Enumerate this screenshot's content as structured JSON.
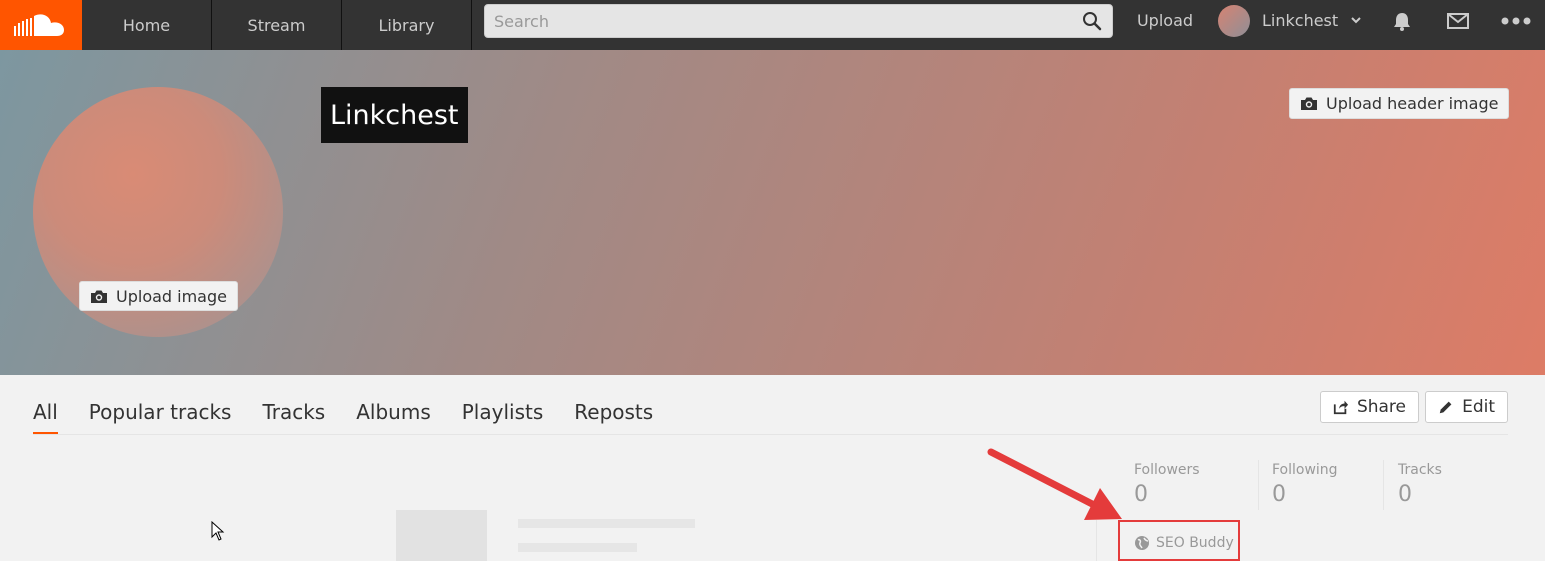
{
  "nav": {
    "home": "Home",
    "stream": "Stream",
    "library": "Library",
    "search_placeholder": "Search",
    "upload": "Upload",
    "username": "Linkchest"
  },
  "profile": {
    "name": "Linkchest",
    "upload_image": "Upload image",
    "upload_header_image": "Upload header image"
  },
  "tabs": [
    "All",
    "Popular tracks",
    "Tracks",
    "Albums",
    "Playlists",
    "Reposts"
  ],
  "actions": {
    "share": "Share",
    "edit": "Edit"
  },
  "stats": {
    "followers_label": "Followers",
    "followers_value": "0",
    "following_label": "Following",
    "following_value": "0",
    "tracks_label": "Tracks",
    "tracks_value": "0"
  },
  "website": "SEO Buddy",
  "colors": {
    "brand": "#ff5500",
    "topbar": "#333333",
    "annotation": "#e43b3b"
  }
}
